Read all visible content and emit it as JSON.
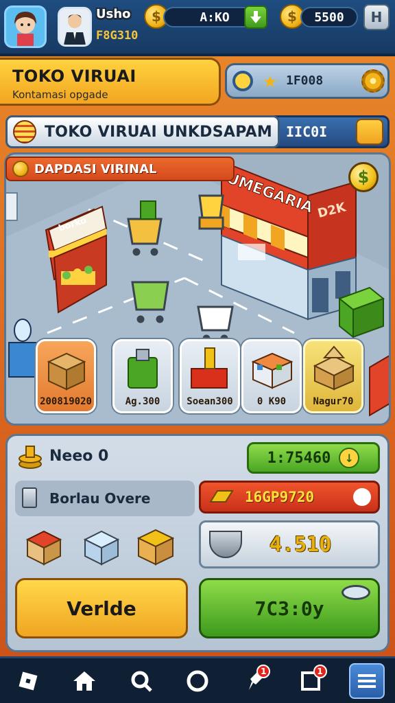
{
  "topbar": {
    "player_name": "Usho",
    "player_id": "F8G310",
    "currency_1": "A:KO",
    "currency_2": "5500",
    "coin_icon": "coin-icon",
    "settings_label": "H"
  },
  "title_banner": {
    "title": "TOKO VIRUAI",
    "subtitle": "Kontamasi opgade"
  },
  "status_panel": {
    "value": "1F008"
  },
  "store_bar": {
    "title": "TOKO VIRUAI UNKDSAPAM",
    "code": "IIC0I"
  },
  "map": {
    "label": "DAPDASI VIRINAL",
    "dollar_symbol": "$",
    "stall_sign": "borko",
    "shop_sign": "UMEGARIA",
    "shop_side_sign": "D2K",
    "items": [
      {
        "label": "200819020",
        "style": "orange"
      },
      {
        "label": "Ag.300",
        "style": "normal"
      },
      {
        "label": "Soean300",
        "style": "normal"
      },
      {
        "label": "0 K90",
        "style": "normal"
      },
      {
        "label": "Nagur70",
        "style": "gold"
      }
    ]
  },
  "panel": {
    "row1_label": "Neeo 0",
    "green_button_value": "1:75460",
    "row2_label": "Borlau Overe",
    "red_button_value": "16GP9720",
    "grey_button_value": "4.510",
    "yellow_button_label": "Verlde",
    "big_green_value": "7C3:0y"
  },
  "navbar": {
    "badge_1": "1",
    "badge_2": "1"
  },
  "colors": {
    "accent_orange": "#e98a2c",
    "accent_blue": "#1f4d80",
    "accent_green": "#4aa623",
    "accent_red": "#c9301a",
    "accent_yellow": "#f2a521"
  }
}
